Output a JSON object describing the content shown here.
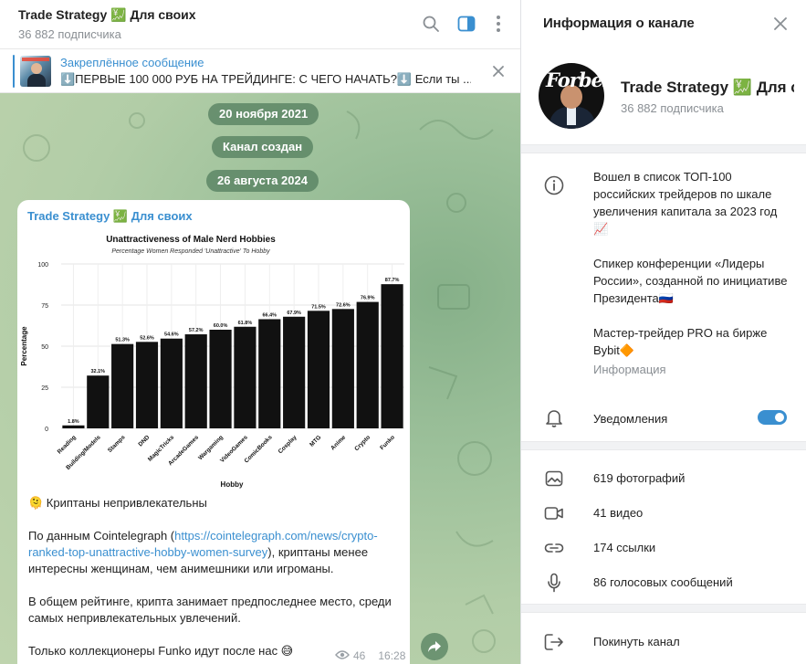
{
  "chat": {
    "title": "Trade Strategy 💹 Для своих",
    "subscribers": "36 882 подписчика",
    "pinned": {
      "label": "Закреплённое сообщение",
      "text": "⬇️ПЕРВЫЕ 100 000 РУБ НА ТРЕЙДИНГЕ: С ЧЕГО НАЧАТЬ?⬇️  Если ты ..."
    },
    "service": {
      "date1": "20 ноября 2021",
      "created": "Канал создан",
      "date2": "26 августа 2024"
    },
    "message": {
      "author": "Trade Strategy 💹 Для своих",
      "line1": "🫠 Криптаны непривлекательны",
      "para2_before": "По данным Cointelegraph (",
      "para2_link": "https://cointelegraph.com/news/crypto-ranked-top-unattractive-hobby-women-survey",
      "para2_after": "), криптаны менее интересны женщинам, чем анимешники или игроманы.",
      "para3": "В общем рейтинге, крипта занимает предпоследнее место, среди самых непривлекательных увлечений.",
      "para4": "Только коллекционеры Funko идут после нас 😅",
      "views": "46",
      "time": "16:28"
    }
  },
  "info": {
    "header": "Информация о канале",
    "channel_name": "Trade Strategy 💹 Для своих",
    "subscribers": "36 882 подписчика",
    "avatar_logo": "Forbes",
    "description": [
      "Вошел в список ТОП-100 российских трейдеров по шкале увеличения капитала за 2023 год📈",
      "Спикер конференции «Лидеры России», созданной по инициативе Президента🇷🇺",
      "Мастер-трейдер PRO на бирже Bybit🔶"
    ],
    "description_label": "Информация",
    "notifications_label": "Уведомления",
    "notifications_on": true,
    "photos": "619 фотографий",
    "videos": "41 видео",
    "links": "174 ссылки",
    "voice": "86 голосовых сообщений",
    "leave": "Покинуть канал"
  },
  "colors": {
    "accent": "#3a8fd0",
    "chat_bg": "#a9c79f",
    "bar": "#111111"
  },
  "chart_data": {
    "type": "bar",
    "title": "Unattractiveness of Male Nerd Hobbies",
    "subtitle": "Percentage Women Responded 'Unattractive' To Hobby",
    "xlabel": "Hobby",
    "ylabel": "Percentage",
    "ylim": [
      0,
      100
    ],
    "yticks": [
      0,
      25,
      50,
      75,
      100
    ],
    "categories": [
      "Reading",
      "Building/Models",
      "Stamps",
      "DND",
      "MagicTricks",
      "ArcadeGames",
      "Wargaming",
      "VideoGames",
      "ComicBooks",
      "Cosplay",
      "MTG",
      "Anime",
      "Crypto",
      "Funko"
    ],
    "values": [
      1.8,
      32.1,
      51.3,
      52.6,
      54.6,
      57.2,
      60.0,
      61.8,
      66.4,
      67.9,
      71.5,
      72.6,
      76.9,
      87.7
    ],
    "labels": [
      "1.8%",
      "32.1%",
      "51.3%",
      "52.6%",
      "54.6%",
      "57.2%",
      "60.0%",
      "61.8%",
      "66.4%",
      "67.9%",
      "71.5%",
      "72.6%",
      "76.9%",
      "87.7%"
    ],
    "grid": true,
    "legend": "none"
  }
}
